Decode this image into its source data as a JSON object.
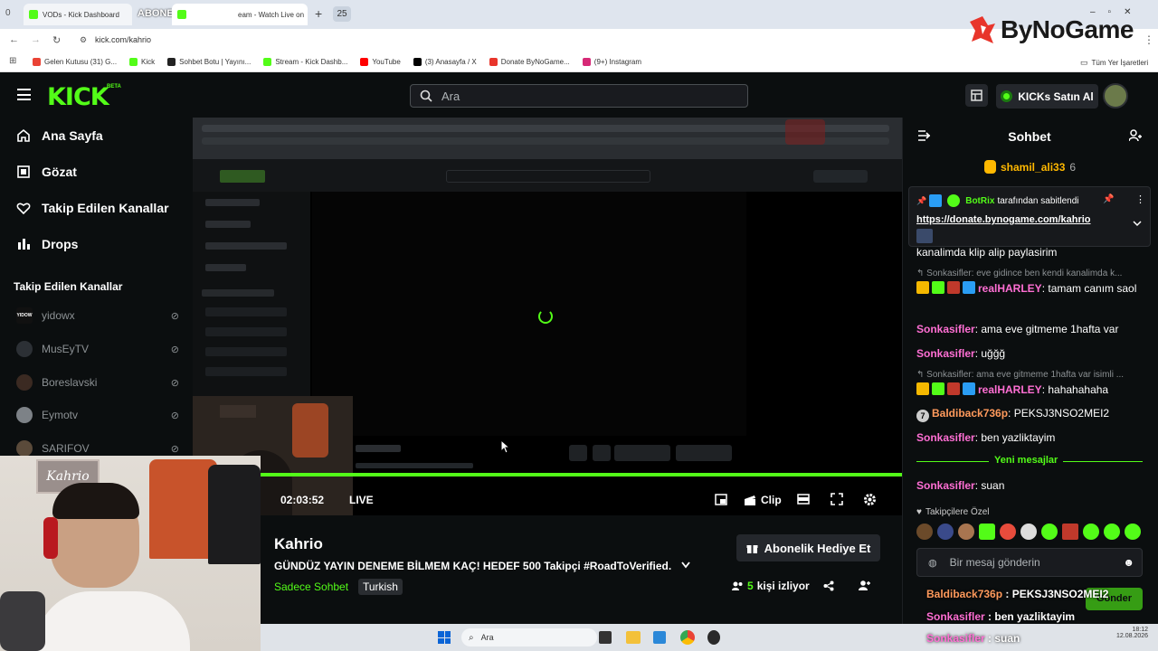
{
  "browser": {
    "tab_count_left": "0",
    "tabs": [
      {
        "label": "VODs - Kick Dashboard"
      },
      {
        "label": "ABONE HEDEFİ"
      },
      {
        "label": "eam - Watch Live on"
      }
    ],
    "tab_count_right": "25",
    "url": "kick.com/kahrio",
    "bookmarks": [
      {
        "label": "Gelen Kutusu (31) G..."
      },
      {
        "label": "Kick"
      },
      {
        "label": "Sohbet Botu | Yayını..."
      },
      {
        "label": "Stream - Kick Dashb..."
      },
      {
        "label": "YouTube"
      },
      {
        "label": "(3) Anasayfa / X"
      },
      {
        "label": "Donate ByNoGame..."
      },
      {
        "label": "(9+) Instagram"
      }
    ],
    "bookmarks_all": "Tüm Yer İşaretleri",
    "watermark": "ByNoGame"
  },
  "header": {
    "logo": "KICK",
    "logo_badge": "BETA",
    "search_placeholder": "Ara",
    "kicks_button": "KICKs Satın Al"
  },
  "sidebar": {
    "nav": [
      {
        "label": "Ana Sayfa"
      },
      {
        "label": "Gözat"
      },
      {
        "label": "Takip Edilen Kanallar"
      },
      {
        "label": "Drops"
      }
    ],
    "followed_title": "Takip Edilen Kanallar",
    "channels": [
      {
        "name": "yidowx",
        "avatar_text": "YIDOW"
      },
      {
        "name": "MusEyTV"
      },
      {
        "name": "Boreslavski"
      },
      {
        "name": "Eymotv"
      },
      {
        "name": "SARIFOV"
      }
    ]
  },
  "player": {
    "time": "02:03:52",
    "live_label": "LIVE",
    "clip_label": "Clip"
  },
  "stream": {
    "channel": "Kahrio",
    "title": "GÜNDÜZ YAYIN DENEME BİLMEM KAÇ! HEDEF 500 Takipçi #RoadToVerified...",
    "tags": [
      "Sadece Sohbet",
      "Turkish"
    ],
    "gift_button": "Abonelik Hediye Et",
    "viewers_count": "5",
    "viewers_label": "kişi izliyor"
  },
  "webcam": {
    "sign": "Kahrio"
  },
  "chat": {
    "title": "Sohbet",
    "top_user": "shamil_ali33",
    "top_user_count": "6",
    "pinned_by": "BotRix",
    "pinned_suffix": "tarafından sabitlendi",
    "pinned_link": "https://donate.bynogame.com/kahrio",
    "messages": [
      {
        "text": "kanalimda klip alip paylasirim"
      },
      {
        "reply": "Sonkasifler: eve gidince ben kendi kanalimda k..."
      },
      {
        "user": "realHARLEY",
        "text": "tamam canım saol"
      },
      {
        "user": "Sonkasifler",
        "text": "ama eve gitmeme 1hafta var"
      },
      {
        "user": "Sonkasifler",
        "text": "uğğğ"
      },
      {
        "reply": "Sonkasifler: ama eve gitmeme 1hafta var isimli ..."
      },
      {
        "user": "realHARLEY",
        "text": "hahahahaha"
      },
      {
        "user": "Baldiback736p",
        "text": "PEKSJ3NSO2MEI2",
        "badge": "7"
      },
      {
        "user": "Sonkasifler",
        "text": "ben yazliktayim"
      },
      {
        "user": "Sonkasifler",
        "text": "suan"
      }
    ],
    "new_messages": "Yeni mesajlar",
    "followers_only": "Takipçilere Özel",
    "input_placeholder": "Bir mesaj gönderin",
    "send_button": "Gönder",
    "overlay": [
      {
        "user": "Baldiback736p",
        "text": "PEKSJ3NSO2MEI2"
      },
      {
        "user": "Sonkasifler",
        "text": "ben yazliktayim"
      },
      {
        "user": "Sonkasifler",
        "text": "suan"
      }
    ]
  },
  "taskbar": {
    "search": "Ara",
    "clock_time": "18:12",
    "clock_date": "12.08.2026"
  },
  "colors": {
    "kick_green": "#53fc18",
    "chat_pink": "#ff6fd4",
    "chat_orange": "#ff9a5c"
  }
}
